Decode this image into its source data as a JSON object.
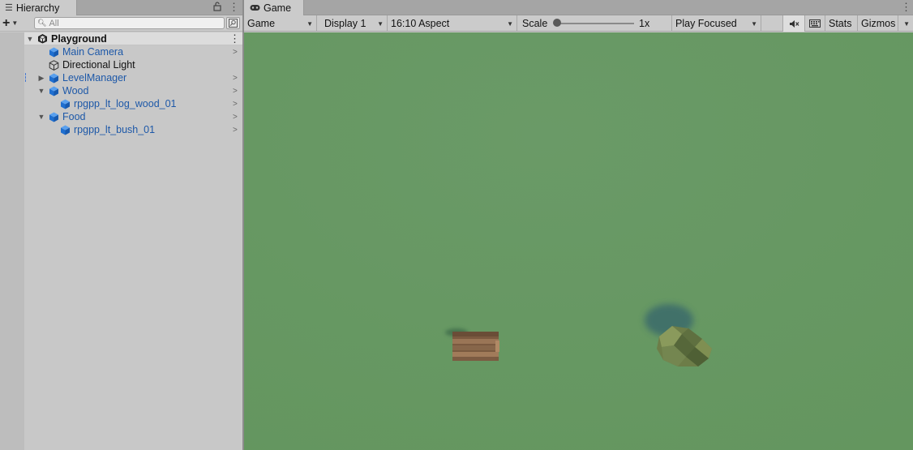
{
  "hierarchy": {
    "tab_label": "Hierarchy",
    "search_placeholder": "All",
    "scene_name": "Playground",
    "items": [
      {
        "label": "Main Camera",
        "kind": "prefab"
      },
      {
        "label": "Directional Light",
        "kind": "plain"
      },
      {
        "label": "LevelManager",
        "kind": "prefab"
      },
      {
        "label": "Wood",
        "kind": "prefab"
      },
      {
        "label": "rpgpp_lt_log_wood_01",
        "kind": "prefab"
      },
      {
        "label": "Food",
        "kind": "prefab"
      },
      {
        "label": "rpgpp_lt_bush_01",
        "kind": "prefab"
      }
    ]
  },
  "game": {
    "tab_label": "Game",
    "toolbar": {
      "view_mode": "Game",
      "display": "Display 1",
      "aspect": "16:10 Aspect",
      "scale_label": "Scale",
      "scale_value": "1x",
      "play_mode": "Play Focused",
      "stats_label": "Stats",
      "gizmos_label": "Gizmos"
    }
  },
  "colors": {
    "prefab_text": "#1d58a8",
    "prefab_icon": "#1f6fd0",
    "viewport_ground": "#679865"
  },
  "icons": {
    "hierarchy_tab": "list-icon",
    "lock": "lock-icon",
    "search": "search-icon",
    "game_tab": "gamepad-icon",
    "mute": "mute-audio-icon",
    "keyboard": "keyboard-icon",
    "scene": "unity-scene-icon",
    "prefab": "prefab-cube-icon",
    "gameobject": "gameobject-cube-icon"
  }
}
